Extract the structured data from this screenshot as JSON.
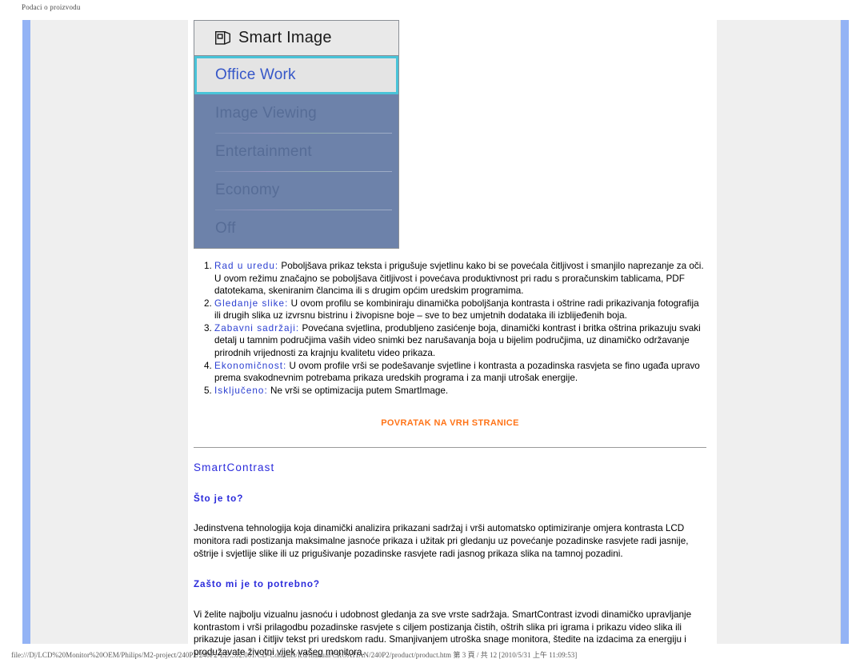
{
  "browser": {
    "window_title": "Podaci o proizvodu",
    "status_bar": "file:///D|/LCD%20Monitor%20OEM/Philips/M2-project/240P2/240P2-ED...02.001/CD-Contents/lcd/manual/CROATIAN/240P2/product/product.htm 第 3 頁 / 共 12 [2010/5/31 上午 11:09:53]"
  },
  "osd": {
    "title": "Smart Image",
    "icon": "smart-image-icon",
    "selected_item": "Office Work",
    "items": [
      "Image Viewing",
      "Entertainment",
      "Economy",
      "Off"
    ]
  },
  "article": {
    "modes": [
      {
        "name": "Rad u uredu:",
        "text": " Poboljšava prikaz teksta i prigušuje svjetlinu kako bi se povećala čitljivost i smanjilo naprezanje za oči. U ovom režimu značajno se poboljšava čitljivost i povećava produktivnost pri radu s proračunskim tablicama, PDF datotekama, skeniranim člancima ili s drugim općim uredskim programima."
      },
      {
        "name": "Gledanje slike:",
        "text": " U ovom profilu se kombiniraju dinamička poboljšanja kontrasta i oštrine radi prikazivanja fotografija ili drugih slika uz izvrsnu bistrinu i živopisne boje – sve to bez umjetnih dodataka ili izblijeđenih boja."
      },
      {
        "name": "Zabavni sadržaji:",
        "text": " Povećana svjetlina, produbljeno zasićenje boja, dinamički kontrast i britka oštrina prikazuju svaki detalj u tamnim područjima vaših video snimki bez narušavanja boja u bijelim područjima, uz dinamičko održavanje prirodnih vrijednosti za krajnju kvalitetu video prikaza."
      },
      {
        "name": "Ekonomičnost:",
        "text": " U ovom profile vrši se podešavanje svjetline i kontrasta a pozadinska rasvjeta se fino ugađa upravo prema svakodnevnim potrebama prikaza uredskih programa i za manji utrošak energije."
      },
      {
        "name": "Isključeno:",
        "text": " Ne vrši se optimizacija putem SmartImage."
      }
    ],
    "back_to_top": "POVRATAK NA VRH STRANICE",
    "section_title": "SmartContrast",
    "sub_title_1": "Što je to?",
    "para_1": "Jedinstvena tehnologija koja dinamički analizira prikazani sadržaj i vrši automatsko optimiziranje omjera kontrasta LCD monitora radi postizanja maksimalne jasnoće prikaza i užitak pri gledanju uz povećanje pozadinske rasvjete radi jasnije, oštrije i svjetlije slike ili uz prigušivanje pozadinske rasvjete radi jasnog prikaza slika na tamnoj pozadini.",
    "sub_title_2": "Zašto mi je to potrebno?",
    "para_2": "Vi želite najbolju vizualnu jasnoću i udobnost gledanja za sve vrste sadržaja. SmartContrast izvodi dinamičko upravljanje kontrastom i vrši prilagodbu pozadinske rasvjete s ciljem postizanja čistih, oštrih slika pri igrama i prikazu video slika ili prikazuje jasan i čitljiv tekst pri uredskom radu. Smanjivanjem utroška snage monitora, štedite na izdacima za energiju i produžavate životni vijek vašeg monitora."
  },
  "colors": {
    "rail": "#93b3f5",
    "canvas": "#efefef",
    "osd_list_bg": "#6d82aa",
    "osd_highlight_border": "#49c3d8",
    "link_orange": "#ff7418",
    "heading_blue": "#2b2bdb"
  }
}
